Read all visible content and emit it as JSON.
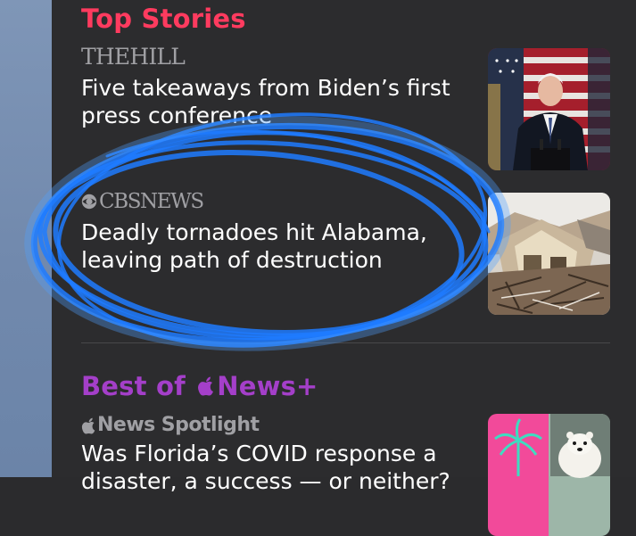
{
  "sections": {
    "top_stories": {
      "title": "Top Stories",
      "color": "#ff3b5f"
    },
    "best_of": {
      "title_prefix": "Best of ",
      "title_suffix": "News+",
      "color": "#a43fc9"
    }
  },
  "stories": [
    {
      "source": "THEHILL",
      "headline": "Five takeaways from Biden’s first press conference",
      "thumbnail_icon": "press-conference-photo"
    },
    {
      "source": "CBSNEWS",
      "headline": "Deadly tornadoes hit Alabama, leaving path of destruction",
      "thumbnail_icon": "tornado-damage-photo"
    },
    {
      "source_part1": "News",
      "source_part2": "Spotlight",
      "headline": "Was Florida’s COVID response a disaster, a success — or neither?",
      "thumbnail_icon": "palm-and-polar-bear-photo"
    }
  ],
  "annotation": {
    "type": "hand-drawn-ellipse",
    "color": "#1e7bff"
  }
}
